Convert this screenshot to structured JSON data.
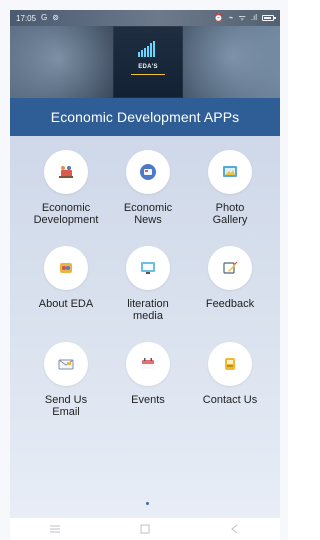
{
  "status_bar": {
    "time": "17:05",
    "left_icons": [
      "G",
      "⊚"
    ],
    "right_icons": [
      "⏰",
      "⌁",
      "ᯤ",
      ".ıl"
    ],
    "battery_label": ""
  },
  "brand": {
    "logo_text": "EDA'S",
    "accent_color": "#f1c13a",
    "banner_colors": [
      "#53677d",
      "#293645",
      "#6c8399"
    ]
  },
  "header": {
    "title": "Economic Development APPs",
    "bar_color": "#2f5e97"
  },
  "tiles": [
    {
      "label": "Economic\nDevelopment",
      "icon": "development-icon"
    },
    {
      "label": "Economic\nNews",
      "icon": "news-icon"
    },
    {
      "label": "Photo\nGallery",
      "icon": "gallery-icon"
    },
    {
      "label": "About EDA",
      "icon": "about-icon"
    },
    {
      "label": "literation\nmedia",
      "icon": "media-icon"
    },
    {
      "label": "Feedback",
      "icon": "feedback-icon"
    },
    {
      "label": "Send Us\nEmail",
      "icon": "email-icon"
    },
    {
      "label": "Events",
      "icon": "events-icon"
    },
    {
      "label": "Contact Us",
      "icon": "contact-icon"
    }
  ],
  "navigation": {
    "menu_icon": "menu-icon",
    "home_icon": "home-icon",
    "back_icon": "back-icon"
  }
}
